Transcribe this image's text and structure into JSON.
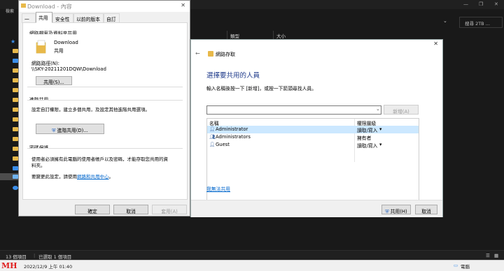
{
  "explorer": {
    "ribbon_tab": "檢索",
    "search_placeholder": "搜尋 2TB ...",
    "columns": [
      "類型",
      "大小"
    ],
    "status_items": "13 個項目",
    "status_selected": "已選取 1 個項目",
    "controls": [
      "—",
      "❐",
      "✕"
    ]
  },
  "taskbar": {
    "datetime": "2022/12/9 上午 01:40",
    "computer_label": "電腦",
    "watermark": "MH"
  },
  "properties": {
    "title": "Download - 內容",
    "close": "✕",
    "tabs": [
      "一般",
      "共用",
      "安全性",
      "以前的版本",
      "自訂"
    ],
    "selected_tab": 1,
    "network_group_title": "網路檔案及資料夾共用",
    "folder_name": "Download",
    "folder_status": "共用",
    "path_label": "網路路徑(N):",
    "path_value": "\\\\SKY-20211201DQW\\Download",
    "share_button": "共用(S)...",
    "advanced_group_title": "進階共用",
    "advanced_desc": "設定自訂權限，建立多個共用，及設定其他進階共用選項。",
    "advanced_button": "進階共用(D)...",
    "password_group_title": "密碼保護",
    "password_desc_1": "使用者必須擁有此電腦的使用者帳戶以及密碼，才能存取您共用的資",
    "password_desc_2": "料夾。",
    "password_change_prefix": "要變更此設定，請使用",
    "password_link": "網路和共用中心",
    "password_change_suffix": "。",
    "ok": "確定",
    "cancel": "取消",
    "apply": "套用(A)"
  },
  "network_access": {
    "back": "←",
    "title": "網路存取",
    "close": "✕",
    "heading": "選擇要共用的人員",
    "instruction": "輸入名稱後按一下 [新增]，或按一下箭頭尋找人員。",
    "combo_value": "",
    "add_button": "新增(A)",
    "col_name": "名稱",
    "col_perm": "權限層級",
    "people": [
      {
        "name": "Administrator",
        "permission": "讀取/寫入",
        "dropdown": true,
        "selected": true
      },
      {
        "name": "Administrators",
        "permission": "擁有者",
        "dropdown": false,
        "selected": false
      },
      {
        "name": "Guest",
        "permission": "讀取/寫入",
        "dropdown": true,
        "selected": false
      }
    ],
    "trouble_link": "我無法共用",
    "share_button": "共用(H)",
    "cancel_button": "取消"
  }
}
